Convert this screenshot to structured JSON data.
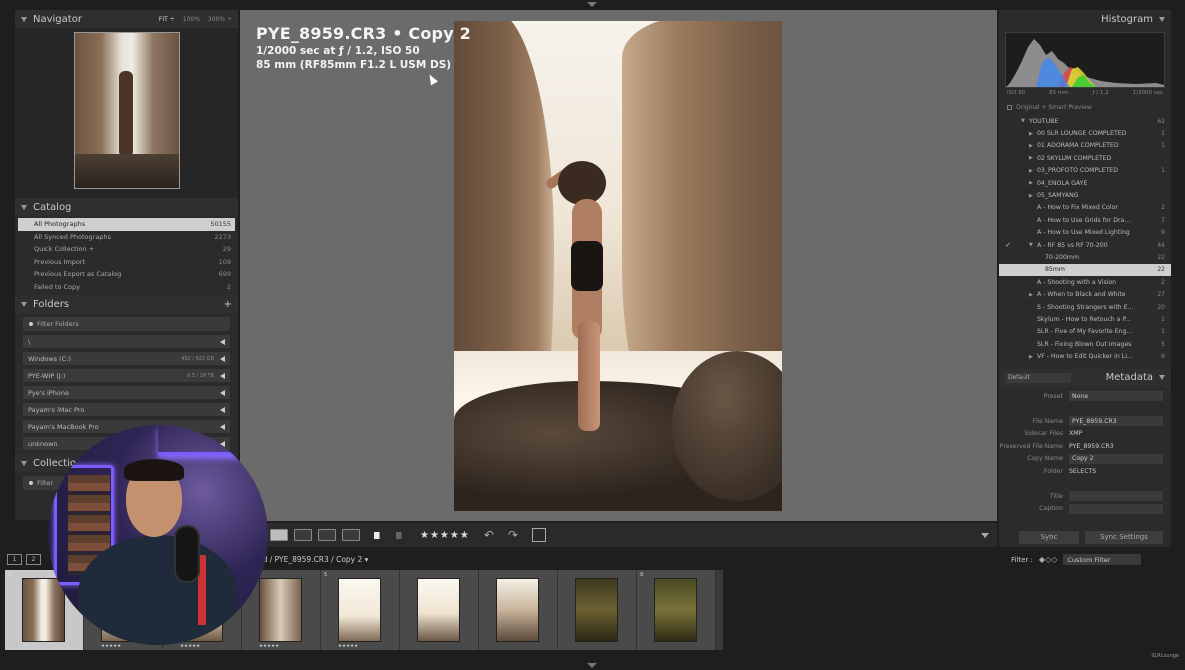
{
  "navigator": {
    "title": "Navigator",
    "options": [
      "FIT ÷",
      "100%",
      "300% ÷"
    ]
  },
  "catalog": {
    "title": "Catalog",
    "items": [
      {
        "name": "All Photographs",
        "count": "50155"
      },
      {
        "name": "All Synced Photographs",
        "count": "2273"
      },
      {
        "name": "Quick Collection +",
        "count": "29"
      },
      {
        "name": "Previous Import",
        "count": "109"
      },
      {
        "name": "Previous Export as Catalog",
        "count": "699"
      },
      {
        "name": "Failed to Copy",
        "count": "2"
      }
    ]
  },
  "folders": {
    "title": "Folders",
    "add_label": "+",
    "filter_placeholder": "Filter Folders",
    "volumes": [
      {
        "name": "\\",
        "size": ""
      },
      {
        "name": "Windows (C:)",
        "size": "492 / 922 GB"
      },
      {
        "name": "PYE-WIP (J:)",
        "size": "9.3 / 18 TB"
      },
      {
        "name": "Pye's iPhone",
        "size": ""
      },
      {
        "name": "Payam's iMac Pro",
        "size": ""
      },
      {
        "name": "Payam's MacBook Pro",
        "size": ""
      },
      {
        "name": "unknown",
        "size": ""
      }
    ]
  },
  "collections_left": {
    "title": "Collection",
    "filter_placeholder": "Filter"
  },
  "photo_info": {
    "title": "PYE_8959.CR3  •  Copy 2",
    "exposure": "1/2000 sec at ƒ / 1.2, ISO 50",
    "lens": "85 mm (RF85mm F1.2 L USM DS)"
  },
  "toolbar": {
    "stars": "★★★★★"
  },
  "histogram": {
    "title": "Histogram",
    "iso": "ISO 50",
    "focal": "85 mm",
    "aperture": "ƒ / 1.2",
    "shutter": "1/2000 sec",
    "smart_preview": "Original + Smart Preview"
  },
  "collections": [
    {
      "check": "",
      "arrow": "▼",
      "indent": 0,
      "name": "YOUTUBE",
      "count": "62",
      "sel": false
    },
    {
      "check": "",
      "arrow": "▶",
      "indent": 1,
      "name": "00 SLR LOUNGE COMPLETED",
      "count": "1",
      "sel": false
    },
    {
      "check": "",
      "arrow": "▶",
      "indent": 1,
      "name": "01 ADORAMA COMPLETED",
      "count": "1",
      "sel": false
    },
    {
      "check": "",
      "arrow": "▶",
      "indent": 1,
      "name": "02 SKYLUM COMPLETED",
      "count": "",
      "sel": false
    },
    {
      "check": "",
      "arrow": "▶",
      "indent": 1,
      "name": "03_PROFOTO COMPLETED",
      "count": "1",
      "sel": false
    },
    {
      "check": "",
      "arrow": "▶",
      "indent": 1,
      "name": "04_ENOLA GAYE",
      "count": "",
      "sel": false
    },
    {
      "check": "",
      "arrow": "▶",
      "indent": 1,
      "name": "05_SAMYANG",
      "count": "",
      "sel": false
    },
    {
      "check": "",
      "arrow": "",
      "indent": 1,
      "name": "A - How to Fix Mixed Color",
      "count": "2",
      "sel": false
    },
    {
      "check": "",
      "arrow": "",
      "indent": 1,
      "name": "A - How to Use Grids for Dra...",
      "count": "7",
      "sel": false
    },
    {
      "check": "",
      "arrow": "",
      "indent": 1,
      "name": "A - How to Use Mixed Lighting",
      "count": "9",
      "sel": false
    },
    {
      "check": "✓",
      "arrow": "▼",
      "indent": 1,
      "name": "A - RF 85 vs RF 70-200",
      "count": "44",
      "sel": false
    },
    {
      "check": "",
      "arrow": "",
      "indent": 2,
      "name": "70-200mm",
      "count": "22",
      "sel": false
    },
    {
      "check": "",
      "arrow": "",
      "indent": 2,
      "name": "85mm",
      "count": "22",
      "sel": true
    },
    {
      "check": "",
      "arrow": "",
      "indent": 1,
      "name": "A - Shooting with a Vision",
      "count": "2",
      "sel": false
    },
    {
      "check": "",
      "arrow": "▶",
      "indent": 1,
      "name": "A - When to Black and White",
      "count": "27",
      "sel": false
    },
    {
      "check": "",
      "arrow": "",
      "indent": 1,
      "name": "S - Shooting Strangers with E...",
      "count": "20",
      "sel": false
    },
    {
      "check": "",
      "arrow": "",
      "indent": 1,
      "name": "Skylum - How to Retouch a P...",
      "count": "1",
      "sel": false
    },
    {
      "check": "",
      "arrow": "",
      "indent": 1,
      "name": "SLR - Five of My Favorite Eng...",
      "count": "1",
      "sel": false
    },
    {
      "check": "",
      "arrow": "",
      "indent": 1,
      "name": "SLR - Fixing Blown Out Images",
      "count": "5",
      "sel": false
    },
    {
      "check": "",
      "arrow": "▶",
      "indent": 1,
      "name": "VF - How to Edit Quicker in Li...",
      "count": "6",
      "sel": false
    }
  ],
  "metadata": {
    "title": "Metadata",
    "preset_select": "Default",
    "rows": [
      {
        "label": "Preset",
        "value": "None",
        "field": true
      },
      {
        "label": "",
        "value": "",
        "field": false
      },
      {
        "label": "File Name",
        "value": "PYE_8959.CR3",
        "field": true
      },
      {
        "label": "Sidecar Files",
        "value": "XMP",
        "field": false
      },
      {
        "label": "Preserved File Name",
        "value": "PYE_8959.CR3",
        "field": false
      },
      {
        "label": "Copy Name",
        "value": "Copy 2",
        "field": true
      },
      {
        "label": "Folder",
        "value": "SELECTS",
        "field": false
      },
      {
        "label": "",
        "value": "",
        "field": false
      },
      {
        "label": "Title",
        "value": "",
        "field": true
      },
      {
        "label": "Caption",
        "value": "",
        "field": true
      }
    ]
  },
  "sync": {
    "sync_label": "Sync",
    "sync_settings_label": "Sync Settings"
  },
  "filmstrip_header": {
    "page1": "1",
    "page2": "2",
    "path": "ed / PYE_8959.CR3 / Copy 2",
    "filter_label": "Filter :",
    "filter_value": "Custom Filter"
  },
  "filmstrip": [
    {
      "num": "1",
      "stars": "★★★★★",
      "sel": true
    },
    {
      "num": "",
      "stars": "★★★★★",
      "sel": false
    },
    {
      "num": "",
      "stars": "★★★★★",
      "sel": false
    },
    {
      "num": "",
      "stars": "★★★★★",
      "sel": false
    },
    {
      "num": "5",
      "stars": "★★★★★",
      "sel": false
    },
    {
      "num": "",
      "stars": "",
      "sel": false
    },
    {
      "num": "",
      "stars": "",
      "sel": false
    },
    {
      "num": "",
      "stars": "",
      "sel": false
    },
    {
      "num": "9",
      "stars": "",
      "sel": false
    }
  ],
  "corner_logo": "SLRLounge",
  "colors": {
    "selection": "#cfcfcf",
    "panel": "#2b2b2b",
    "center_bg": "#6b6b6b",
    "accent_purple": "#7b5cff"
  }
}
